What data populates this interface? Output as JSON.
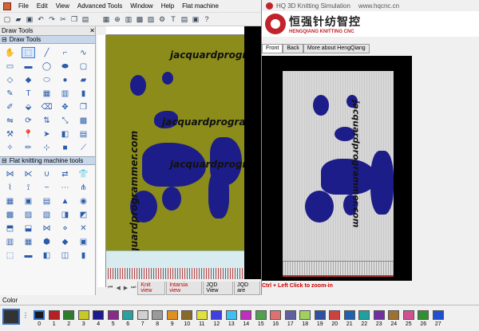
{
  "menu": {
    "items": [
      "File",
      "Edit",
      "View",
      "Advanced Tools",
      "Window",
      "Help",
      "Flat machine"
    ]
  },
  "left_panel": {
    "title": "Draw Tools",
    "draw_tools_section": "Draw Tools",
    "flat_section": "Flat knitting machine tools"
  },
  "canvas": {
    "watermark": "jacquardprogrammer.com",
    "tabs": [
      "Knit view",
      "Intarsia view",
      "JQD View",
      "JQD are"
    ]
  },
  "simulation": {
    "window_title": "HQ 3D Knitting Simulation",
    "website": "www.hqcnc.cn",
    "brand_cn": "恒强针纺智控",
    "brand_en": "HENGQIANG KNITTING CNC",
    "tabs": [
      "Front",
      "Back",
      "More about HengQiang"
    ],
    "hint": "Ctrl + Left Click to zoom-in"
  },
  "color_bar": {
    "label": "Color",
    "swatches": [
      {
        "num": "0",
        "color": "#1b1b1b"
      },
      {
        "num": "1",
        "color": "#b52020"
      },
      {
        "num": "2",
        "color": "#2d7d2d"
      },
      {
        "num": "3",
        "color": "#c8c826"
      },
      {
        "num": "4",
        "color": "#1c1c8c"
      },
      {
        "num": "5",
        "color": "#8a2a8a"
      },
      {
        "num": "6",
        "color": "#2aa0a0"
      },
      {
        "num": "7",
        "color": "#d0d0d0"
      },
      {
        "num": "8",
        "color": "#9a9a9a"
      },
      {
        "num": "9",
        "color": "#e09020"
      },
      {
        "num": "10",
        "color": "#8a6a2a"
      },
      {
        "num": "11",
        "color": "#e0e040"
      },
      {
        "num": "12",
        "color": "#4040e0"
      },
      {
        "num": "13",
        "color": "#40c0f0"
      },
      {
        "num": "14",
        "color": "#c030c0"
      },
      {
        "num": "15",
        "color": "#50a050"
      },
      {
        "num": "16",
        "color": "#e07070"
      },
      {
        "num": "17",
        "color": "#6060a0"
      },
      {
        "num": "18",
        "color": "#a0d060"
      },
      {
        "num": "19",
        "color": "#3050a0"
      },
      {
        "num": "20",
        "color": "#d04040"
      },
      {
        "num": "21",
        "color": "#2060b0"
      },
      {
        "num": "22",
        "color": "#20a0a0"
      },
      {
        "num": "23",
        "color": "#7030a0"
      },
      {
        "num": "24",
        "color": "#a07030"
      },
      {
        "num": "25",
        "color": "#d05090"
      },
      {
        "num": "26",
        "color": "#309030"
      },
      {
        "num": "27",
        "color": "#2050d0"
      }
    ]
  }
}
